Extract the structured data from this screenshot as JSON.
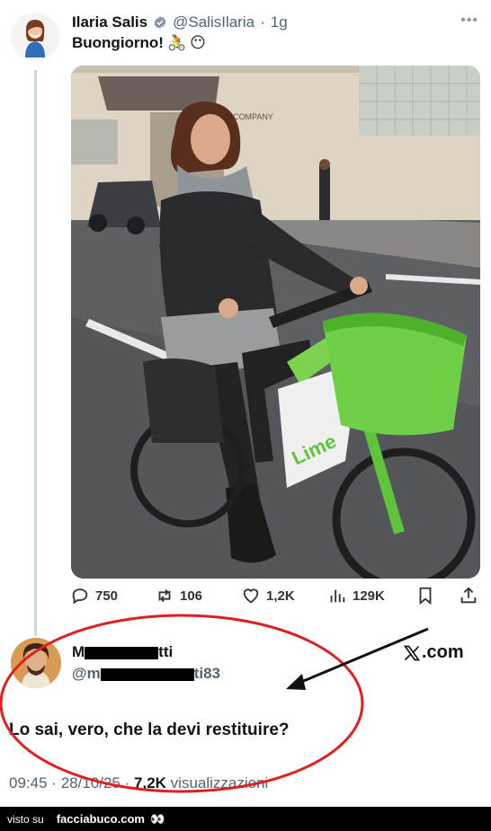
{
  "tweet": {
    "author_name": "Ilaria Salis",
    "author_handle": "@SalisIlaria",
    "time_sep": "·",
    "time": "1g",
    "text": "Buongiorno!",
    "emoji_bike": "🚴",
    "emoji_face": "😶"
  },
  "actions": {
    "replies": "750",
    "reposts": "106",
    "likes": "1,2K",
    "views": "129K"
  },
  "reply": {
    "name_start": "M",
    "name_end": "tti",
    "handle_start": "@m",
    "handle_end": "ti83",
    "watermark": ".com",
    "text": "Lo sai, vero, che la devi restituire?",
    "time": "09:45",
    "date": "28/10/25",
    "views_count": "7,2K",
    "views_label": "visualizzazioni",
    "sep": "·"
  },
  "photo": {
    "bike_brand": "Lime",
    "storefront_sign": "COMPANY"
  },
  "footer": {
    "prefix": "visto su",
    "site": "facciabuco.com",
    "eyes": "👀"
  },
  "colors": {
    "annotation_red": "#e02020",
    "lime_green": "#5fc43b",
    "muted_text": "#536471"
  }
}
